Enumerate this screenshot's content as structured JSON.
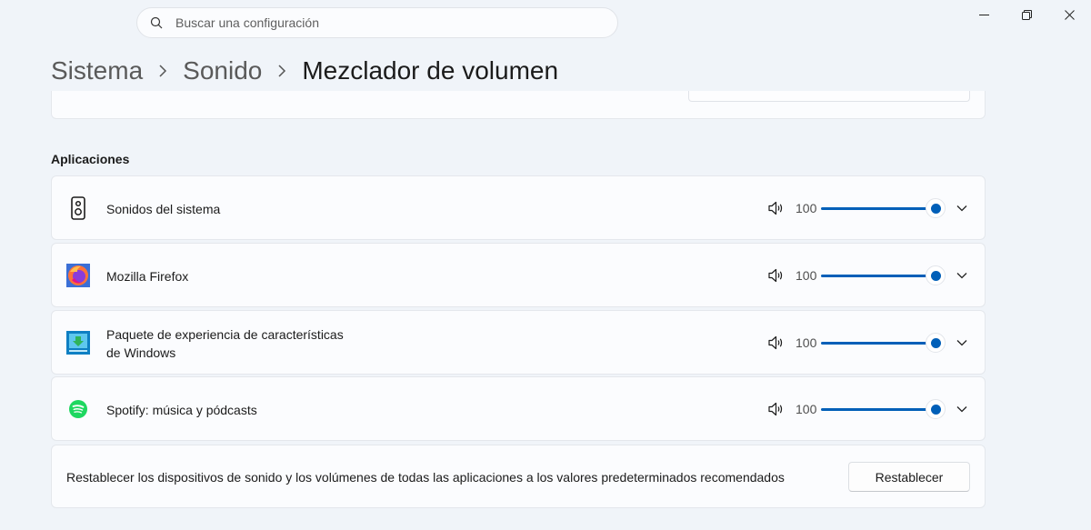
{
  "search": {
    "placeholder": "Buscar una configuración"
  },
  "breadcrumb": {
    "items": [
      "Sistema",
      "Sonido"
    ],
    "current": "Mezclador de volumen"
  },
  "section_title": "Aplicaciones",
  "apps": [
    {
      "name_line1": "Sonidos del sistema",
      "name_line2": "",
      "icon": "speaker-icon",
      "volume": "100",
      "volume_level": 100
    },
    {
      "name_line1": "Mozilla Firefox",
      "name_line2": "",
      "icon": "firefox-icon",
      "volume": "100",
      "volume_level": 100
    },
    {
      "name_line1": "Paquete de experiencia de características",
      "name_line2": "de Windows",
      "icon": "feature-pack-icon",
      "volume": "100",
      "volume_level": 100
    },
    {
      "name_line1": "Spotify: música y pódcasts",
      "name_line2": "",
      "icon": "spotify-icon",
      "volume": "100",
      "volume_level": 100
    }
  ],
  "reset": {
    "text": "Restablecer los dispositivos de sonido y los volúmenes de todas las aplicaciones a los valores predeterminados recomendados",
    "button_label": "Restablecer"
  },
  "colors": {
    "accent": "#005fb8",
    "background": "#f0f4f9",
    "card": "#fbfcfe"
  }
}
